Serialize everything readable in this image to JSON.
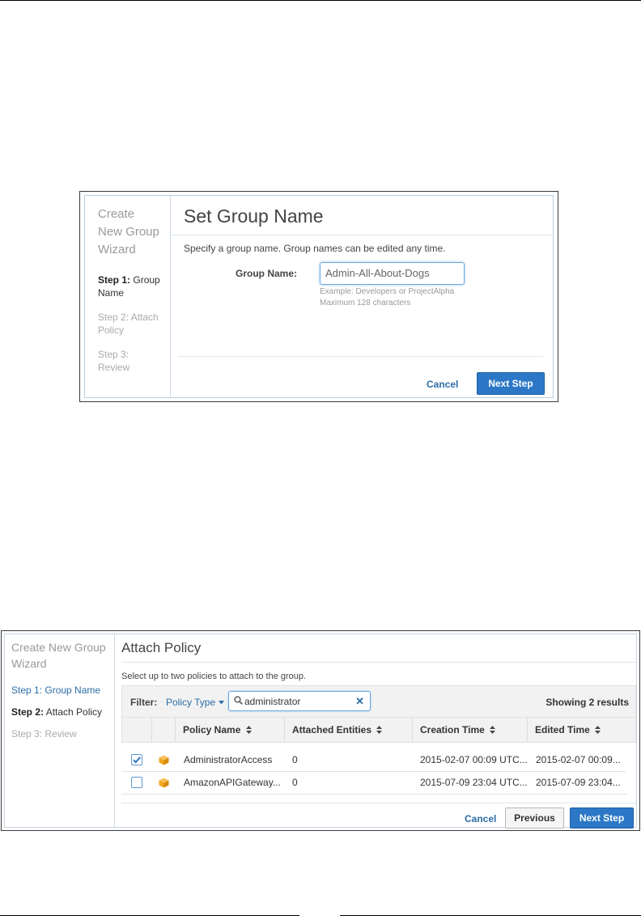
{
  "wizard1": {
    "sidebar": {
      "title": "Create New Group Wizard",
      "steps": [
        {
          "prefix": "Step 1:",
          "label": "Group Name"
        },
        {
          "prefix": "Step 2:",
          "label": "Attach Policy"
        },
        {
          "prefix": "Step 3:",
          "label": "Review"
        }
      ]
    },
    "title": "Set Group Name",
    "description": "Specify a group name. Group names can be edited any time.",
    "field_label": "Group Name:",
    "field_value": "Admin-All-About-Dogs",
    "hint1": "Example: Developers or ProjectAlpha",
    "hint2": "Maximum 128 characters",
    "cancel_label": "Cancel",
    "next_label": "Next Step"
  },
  "wizard2": {
    "sidebar": {
      "title": "Create New Group Wizard",
      "steps": [
        {
          "prefix": "Step 1:",
          "label": "Group Name"
        },
        {
          "prefix": "Step 2:",
          "label": "Attach Policy"
        },
        {
          "prefix": "Step 3:",
          "label": "Review"
        }
      ]
    },
    "title": "Attach Policy",
    "description": "Select up to two policies to attach to the group.",
    "filter_label": "Filter:",
    "policy_type_label": "Policy Type",
    "search_value": "administrator",
    "results": "Showing 2 results",
    "columns": [
      "Policy Name",
      "Attached Entities",
      "Creation Time",
      "Edited Time"
    ],
    "rows": [
      {
        "checked": true,
        "name": "AdministratorAccess",
        "entities": "0",
        "created": "2015-02-07 00:09 UTC...",
        "edited": "2015-02-07 00:09..."
      },
      {
        "checked": false,
        "name": "AmazonAPIGateway...",
        "entities": "0",
        "created": "2015-07-09 23:04 UTC...",
        "edited": "2015-07-09 23:04..."
      }
    ],
    "cancel_label": "Cancel",
    "previous_label": "Previous",
    "next_label": "Next Step"
  },
  "colors": {
    "primary_button": "#2c78c6",
    "link": "#2d6da6",
    "policy_icon": "#f0a51c"
  },
  "icons": {
    "sort": "sort-arrows-icon",
    "policy": "policy-cube-icon",
    "search": "search-icon",
    "clear": "clear-icon"
  }
}
